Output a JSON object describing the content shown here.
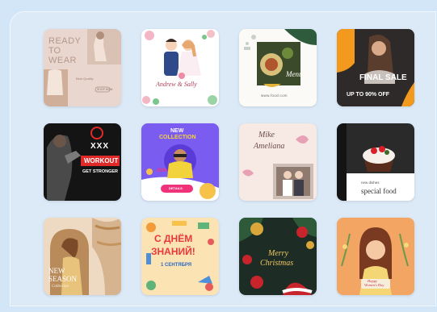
{
  "templates": [
    {
      "id": "ready-to-wear",
      "line1": "READY",
      "line2": "TO",
      "line3": "WEAR",
      "small": "Best Quality",
      "tag": "SHOP NOW"
    },
    {
      "id": "wedding",
      "names": "Andrew & Sally"
    },
    {
      "id": "menu",
      "title": "Menu",
      "url": "www.food.com"
    },
    {
      "id": "final-sale",
      "headline": "FINAL SALE",
      "sub": "UP TO 90% OFF"
    },
    {
      "id": "workout",
      "marks": "XXX",
      "title": "WORKOUT",
      "sub": "GET STRONGER"
    },
    {
      "id": "new-collection",
      "line1": "NEW",
      "line2": "COLLECTION",
      "discount": "-20%",
      "button": "DETAILS"
    },
    {
      "id": "wedding-invite",
      "name1": "Mike",
      "name2": "Ameliana"
    },
    {
      "id": "special-food",
      "small": "new dishes",
      "title": "special food"
    },
    {
      "id": "new-season",
      "line1": "NEW",
      "line2": "SEASON",
      "sub": "Collection"
    },
    {
      "id": "first-september",
      "line1": "С ДНЁМ",
      "line2": "ЗНАНИЙ!",
      "line3": "1 СЕНТЯБРЯ"
    },
    {
      "id": "christmas",
      "line1": "Merry",
      "line2": "Christmas"
    },
    {
      "id": "womens-day",
      "line1": "Happy",
      "line2": "Women's Day"
    }
  ],
  "colors": {
    "background": "#d3e6f8",
    "sale_orange": "#f39a1e",
    "workout_red": "#e02a2a",
    "collection_purple": "#7b5cf0",
    "christmas_red": "#c8242c"
  }
}
